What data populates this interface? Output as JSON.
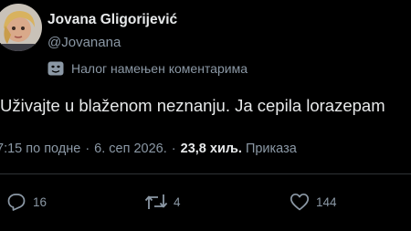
{
  "author": {
    "display_name": "Jovana Gligorijević",
    "handle": "@Jovanana",
    "account_label": "Налог намењен коментарима",
    "avatar_icon": "avatar-photo",
    "label_icon": "theater-mask-icon"
  },
  "tweet": {
    "text": "Uživajte u blaženom neznanju. Ja cepila lorazepam"
  },
  "meta": {
    "time": "7:15 по подне",
    "separator": "·",
    "date": "6. сеп 2026.",
    "views_count": "23,8 хиљ.",
    "views_label": "Приказа"
  },
  "actions": {
    "replies": "16",
    "reposts": "4",
    "likes": "144"
  },
  "colors": {
    "background": "#000000",
    "primary_text": "#e7e9ea",
    "secondary_text": "#8b98a5",
    "divider": "#2f3336"
  }
}
